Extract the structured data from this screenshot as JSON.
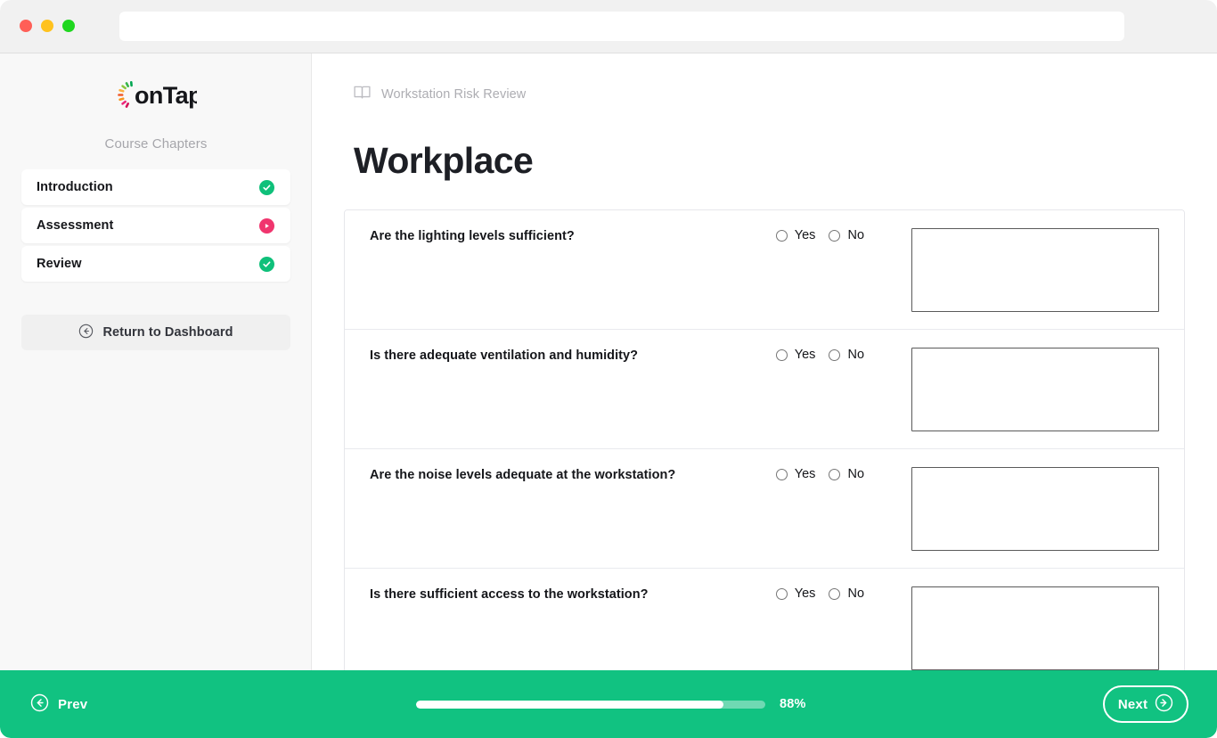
{
  "browser": {
    "traffic_lights": [
      {
        "name": "close",
        "color": "#ff5f57"
      },
      {
        "name": "minimize",
        "color": "#ffc21e"
      },
      {
        "name": "maximize",
        "color": "#1fd71f"
      }
    ],
    "url_value": "",
    "url_placeholder": ""
  },
  "sidebar": {
    "logo_text": "onTap",
    "chapters_label": "Course Chapters",
    "chapters": [
      {
        "label": "Introduction",
        "status": "complete",
        "icon": "check-circle-icon",
        "color": "#0fc07a"
      },
      {
        "label": "Assessment",
        "status": "in-progress",
        "icon": "play-circle-icon",
        "color": "#f0356e"
      },
      {
        "label": "Review",
        "status": "complete",
        "icon": "check-circle-icon",
        "color": "#0fc07a"
      }
    ],
    "return_button": {
      "label": "Return to Dashboard",
      "icon": "arrow-left-circle-icon"
    }
  },
  "main": {
    "breadcrumb": {
      "icon": "book-icon",
      "text": "Workstation Risk Review"
    },
    "title": "Workplace",
    "radio_options": {
      "yes": "Yes",
      "no": "No"
    },
    "questions": [
      {
        "text": "Are the lighting levels sufficient?",
        "answer": "",
        "note": "",
        "note_placeholder": ""
      },
      {
        "text": "Is there adequate ventilation and humidity?",
        "answer": "",
        "note": "",
        "note_placeholder": ""
      },
      {
        "text": "Are the noise levels adequate at the workstation?",
        "answer": "",
        "note": "",
        "note_placeholder": ""
      },
      {
        "text": "Is there sufficient access to the workstation?",
        "answer": "",
        "note": "",
        "note_placeholder": ""
      }
    ]
  },
  "footer": {
    "prev_label": "Prev",
    "prev_icon": "arrow-left-circle-icon",
    "next_label": "Next",
    "next_icon": "arrow-right-circle-icon",
    "progress_percent": 88,
    "progress_label": "88%",
    "accent_color": "#11c281"
  }
}
